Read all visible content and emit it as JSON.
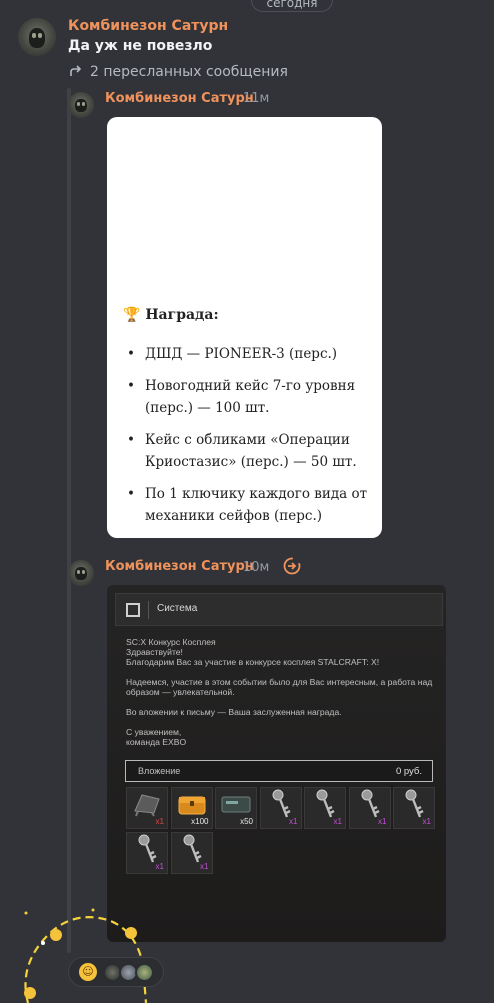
{
  "date_divider": "сегодня",
  "messages": [
    {
      "author": "Комбинезон Сатурн",
      "text": "Да уж не повезло",
      "forward_label": "2 пересланных сообщения"
    }
  ],
  "forwarded": [
    {
      "author": "Комбинезон Сатурн",
      "time": "11м",
      "card": {
        "heading": "Награда:",
        "items": [
          "ДШД — PIONEER-3 (перс.)",
          "Новогодний кейс 7-го уровня (перс.) —  100 шт.",
          "Кейс с обликами «Операции Криостазис» (перс.) —  50 шт.",
          "По 1 ключику каждого вида от механики сейфов (перс.)"
        ]
      }
    },
    {
      "author": "Комбинезон Сатурн",
      "time": "10м",
      "game_mail": {
        "window_title": "Система",
        "lines": [
          [
            "SC:X Конкурс Косплея",
            "Здравствуйте!",
            "Благодарим Вас за участие в конкурсе косплея STALCRAFT: X!"
          ],
          [
            "Надеемся, участие в этом событии было для Вас интересным, а работа над образом — увлекательной."
          ],
          [
            "Во вложении к письму — Ваша заслуженная награда."
          ],
          [
            "С уважением,",
            "команда EXBO"
          ]
        ],
        "attachment_label": "Вложение",
        "attachment_value": "0 руб.",
        "slots": [
          {
            "icon": "case-icon",
            "qty": "x1",
            "qty_color": "#e0453f"
          },
          {
            "icon": "chest-icon",
            "qty": "x100",
            "qty_color": "#e8e8e8"
          },
          {
            "icon": "container-icon",
            "qty": "x50",
            "qty_color": "#e8e8e8"
          },
          {
            "icon": "key-icon",
            "qty": "x1",
            "qty_color": "#c24fd6"
          },
          {
            "icon": "key-icon",
            "qty": "x1",
            "qty_color": "#c24fd6"
          },
          {
            "icon": "key-icon",
            "qty": "x1",
            "qty_color": "#c24fd6"
          },
          {
            "icon": "key-icon",
            "qty": "x1",
            "qty_color": "#c24fd6"
          },
          {
            "icon": "key-icon",
            "qty": "x1",
            "qty_color": "#c24fd6"
          },
          {
            "icon": "key-icon",
            "qty": "x1",
            "qty_color": "#c24fd6"
          }
        ]
      }
    }
  ],
  "colors": {
    "author": "#f0925b",
    "background": "#313338"
  },
  "reaction": {
    "emoji": "laughing-emoji"
  }
}
